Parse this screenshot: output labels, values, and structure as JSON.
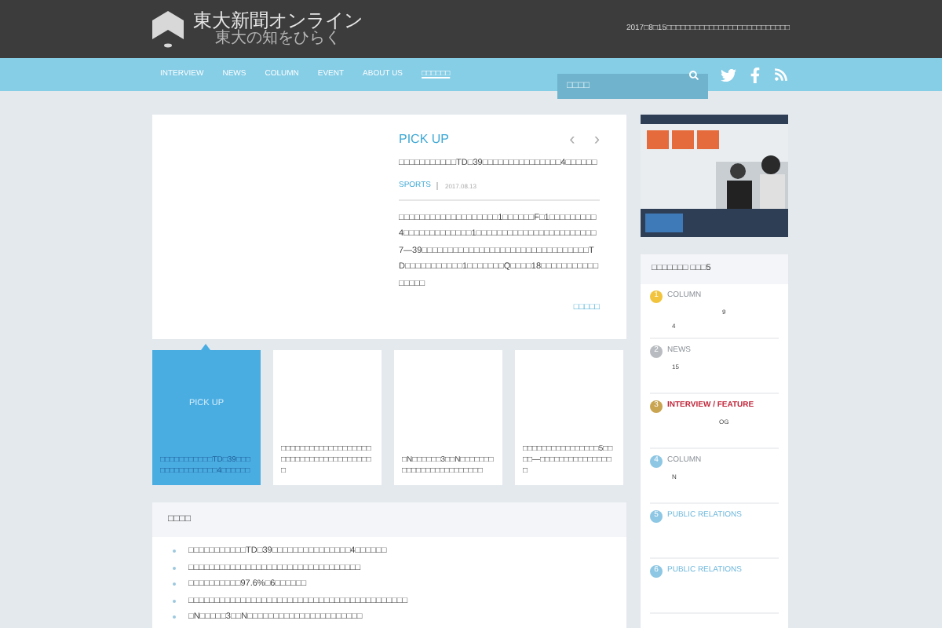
{
  "header": {
    "logo_title": "東大新聞オンライン",
    "logo_subtitle": "東大の知をひらく",
    "notice": "2017□8□15□□□□□□□□□□□□□□□□□□□□□□□□□□"
  },
  "nav": {
    "items": [
      {
        "label": "INTERVIEW"
      },
      {
        "label": "NEWS"
      },
      {
        "label": "COLUMN"
      },
      {
        "label": "EVENT"
      },
      {
        "label": "ABOUT US"
      },
      {
        "label": "□□□□□□",
        "kind": "boxed"
      }
    ],
    "search_placeholder": "□□□□"
  },
  "pickup": {
    "heading": "PICK UP",
    "prev": "‹",
    "next": "›",
    "title": "□□□□□□□□□□□TD□39□□□□□□□□□□□□□□□4□□□□□□",
    "category": "SPORTS",
    "date": "2017.08.13",
    "body": "□□□□□□□□□□□□□□□□□□□1□□□□□□F□1□□□□□□□□□4□□□□□□□□□□□□□1□□□□□□□□□□□□□□□□□□□□□□□7—39□□□□□□□□□□□□□□□□□□□□□□□□□□□□□□□□TD□□□□□□□□□□□1□□□□□□□Q□□□□18□□□□□□□□□□□□□□□□",
    "more": "□□□□□"
  },
  "thumbs": [
    {
      "selected": true,
      "label": "PICK UP",
      "text": "□□□□□□□□□□□TD□39□□□□□□□□□□□□□□□4□□□□□□"
    },
    {
      "selected": false,
      "text": "□□□□□□□□□□□□□□□□□□□□□□□□□□□□□□□□□□□□□□□"
    },
    {
      "selected": false,
      "text": "□N□□□□□□3□□N□□□□□□□□□□□□□□□□□□□□□□□□"
    },
    {
      "selected": false,
      "text": "□□□□□□□□□□□□□□□□5□□□□—□□□□□□□□□□□□□□□□"
    }
  ],
  "news": {
    "heading": "□□□□",
    "items": [
      "□□□□□□□□□□□TD□39□□□□□□□□□□□□□□□4□□□□□□",
      "□□□□□□□□□□□□□□□□□□□□□□□□□□□□□□□□□",
      "□□□□□□□□□□97.6%□6□□□□□□",
      "□□□□□□□□□□□□□□□□□□□□□□□□□□□□□□□□□□□□□□□□□□",
      "□N□□□□□3□□N□□□□□□□□□□□□□□□□□□□□□□"
    ]
  },
  "ranking": {
    "heading": "□□□□□□□ □□□5",
    "items": [
      {
        "rank": "1",
        "color": "#f2c43d",
        "category": "COLUMN",
        "kind": "plain",
        "lines": [
          "9",
          "4"
        ]
      },
      {
        "rank": "2",
        "color": "#b8bcc0",
        "category": "NEWS",
        "kind": "plain",
        "lines": [
          "15"
        ]
      },
      {
        "rank": "3",
        "color": "#c9a451",
        "category": "INTERVIEW / FEATURE",
        "kind": "feature",
        "lines": [
          "OG"
        ]
      },
      {
        "rank": "4",
        "color": "#8dc7e4",
        "category": "COLUMN",
        "kind": "plain",
        "lines": [
          "N"
        ]
      },
      {
        "rank": "5",
        "color": "#8dc7e4",
        "category": "PUBLIC RELATIONS",
        "kind": "relations"
      },
      {
        "rank": "6",
        "color": "#8dc7e4",
        "category": "PUBLIC RELATIONS",
        "kind": "relations"
      }
    ]
  }
}
